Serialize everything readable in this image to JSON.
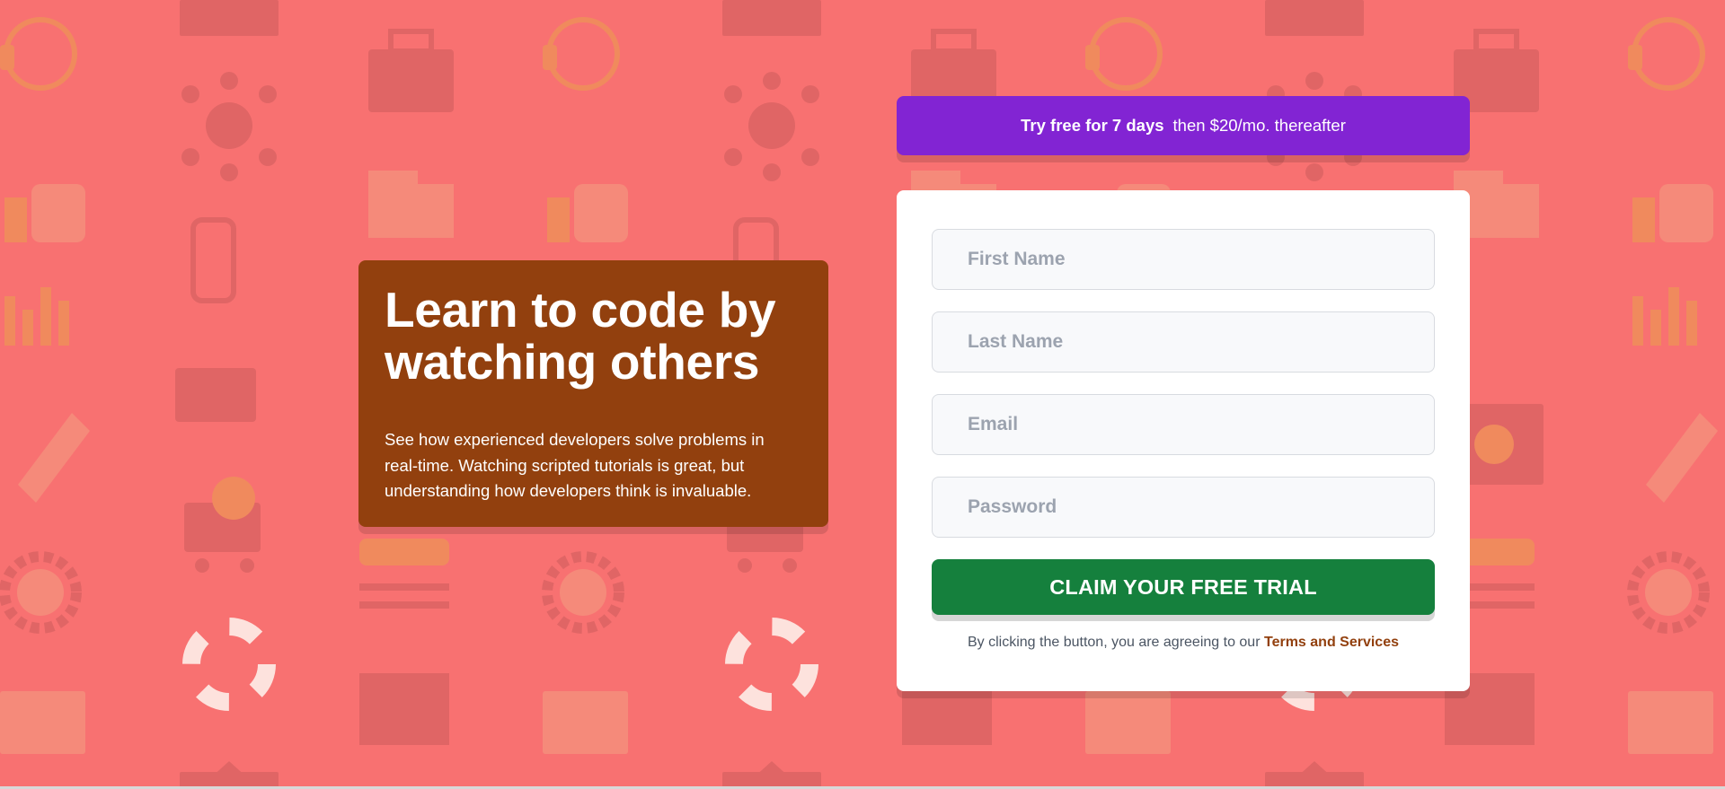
{
  "background": {
    "color": "#f87171",
    "icon_pattern": [
      "home-icon",
      "toolbox-icon",
      "headset-icon",
      "network-icon",
      "thumbs-up-icon",
      "chart-icon",
      "rocket-icon",
      "gear-icon",
      "cart-icon",
      "globe-icon",
      "lifebuoy-icon",
      "calendar-icon",
      "browser-icon",
      "search-icon",
      "key-icon"
    ]
  },
  "hero": {
    "title": "Learn to code by watching others",
    "description": "See how experienced developers solve problems in real-time. Watching scripted tutorials is great, but understanding how developers think is invaluable.",
    "color": "#92400e"
  },
  "promo": {
    "bold_text": "Try free for 7 days",
    "rest_text": "then $20/mo. thereafter",
    "color": "#8224d3"
  },
  "form": {
    "first_name": {
      "placeholder": "First Name",
      "value": ""
    },
    "last_name": {
      "placeholder": "Last Name",
      "value": ""
    },
    "email": {
      "placeholder": "Email",
      "value": ""
    },
    "password": {
      "placeholder": "Password",
      "value": ""
    },
    "submit_label": "CLAIM YOUR FREE TRIAL",
    "submit_color": "#15803d",
    "terms_prefix": "By clicking the button, you are agreeing to our",
    "terms_link": "Terms and Services"
  }
}
